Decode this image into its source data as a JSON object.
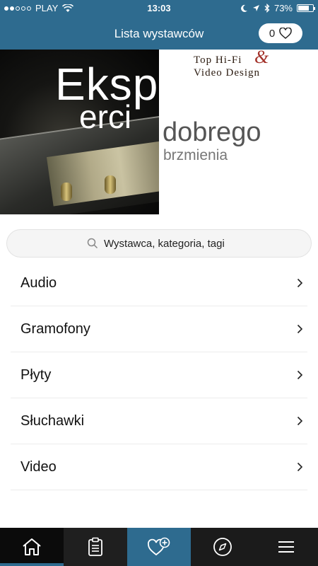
{
  "status_bar": {
    "carrier": "PLAY",
    "time": "13:03",
    "battery": "73%",
    "battery_level": 0.73,
    "icons": [
      "signal-dots-icon",
      "wifi-icon",
      "moon-icon",
      "location-arrow-icon",
      "bluetooth-icon",
      "battery-icon"
    ]
  },
  "header": {
    "title": "Lista wystawców",
    "favorites_count": "0",
    "favorites_icon": "heart-icon"
  },
  "banner": {
    "headline_1": "Eksp",
    "headline_2": "erci",
    "tagline_1": "dobrego",
    "tagline_2": "brzmienia",
    "brand_line_1": "Top Hi-Fi",
    "brand_ampersand": "&",
    "brand_line_2": "Video Design"
  },
  "search": {
    "placeholder": "Wystawca, kategoria, tagi",
    "icon": "search-icon"
  },
  "categories": [
    {
      "label": "Audio"
    },
    {
      "label": "Gramofony"
    },
    {
      "label": "Płyty"
    },
    {
      "label": "Słuchawki"
    },
    {
      "label": "Video"
    }
  ],
  "tabbar": {
    "tabs": [
      {
        "name": "home",
        "icon": "home-icon",
        "active": true
      },
      {
        "name": "list",
        "icon": "clipboard-icon"
      },
      {
        "name": "favorites",
        "icon": "heart-plus-icon",
        "selected": true
      },
      {
        "name": "explore",
        "icon": "compass-icon"
      },
      {
        "name": "menu",
        "icon": "hamburger-menu-icon"
      }
    ]
  },
  "colors": {
    "primary": "#2e6b8f",
    "tabbar_dark": "#1b1b1b",
    "brand_red": "#a3322a"
  }
}
